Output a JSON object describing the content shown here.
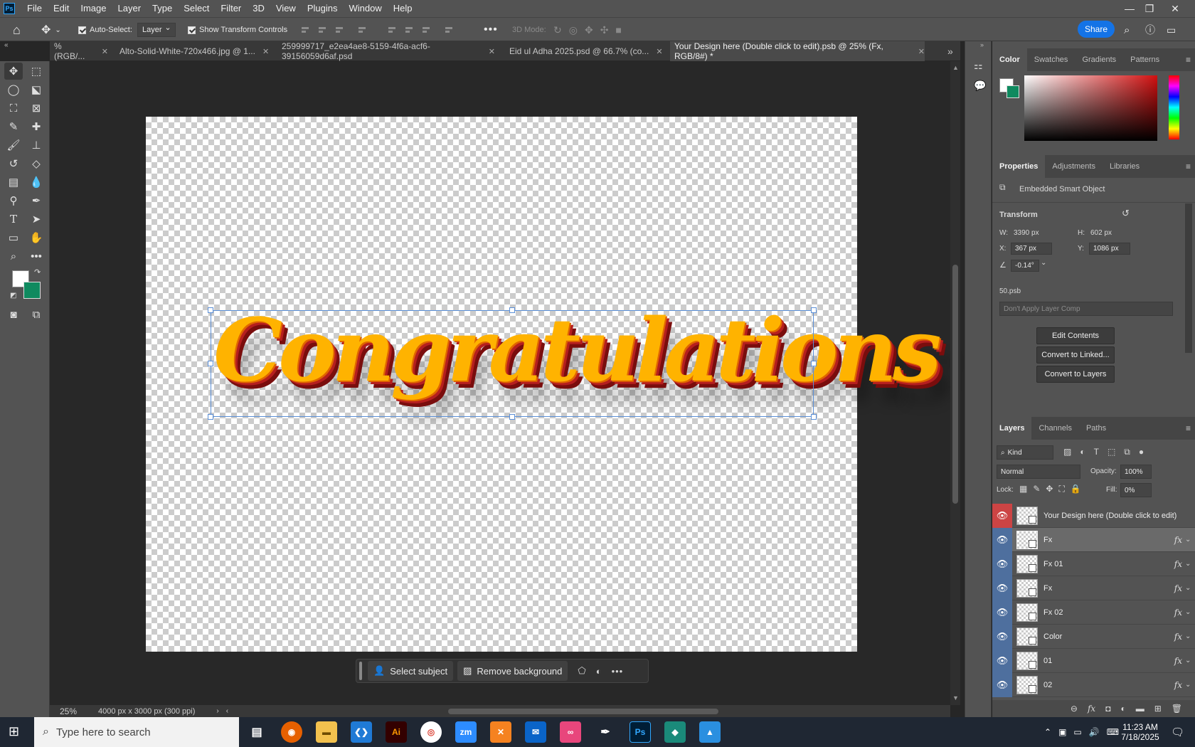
{
  "menu": [
    "File",
    "Edit",
    "Image",
    "Layer",
    "Type",
    "Select",
    "Filter",
    "3D",
    "View",
    "Plugins",
    "Window",
    "Help"
  ],
  "options_bar": {
    "auto_select_label": "Auto-Select:",
    "auto_select_value": "Layer",
    "show_transform_label": "Show Transform Controls",
    "mode_3d_label": "3D Mode:",
    "share_label": "Share"
  },
  "tabs": [
    {
      "label": "% (RGB/..."
    },
    {
      "label": "Alto-Solid-White-720x466.jpg @ 1..."
    },
    {
      "label": "259999717_e2ea4ae8-5159-4f6a-acf6-39156059d6af.psd"
    },
    {
      "label": "Eid ul Adha 2025.psd @ 66.7% (co..."
    },
    {
      "label": "Your Design here (Double click to edit).psb @ 25% (Fx, RGB/8#) *"
    }
  ],
  "canvas": {
    "art_text": "Congratulations"
  },
  "context_bar": {
    "select_subject": "Select subject",
    "remove_background": "Remove background"
  },
  "status": {
    "zoom": "25%",
    "doc_info": "4000 px x 3000 px (300 ppi)"
  },
  "color_panel": {
    "tabs": [
      "Color",
      "Swatches",
      "Gradients",
      "Patterns"
    ],
    "foreground": "#ffffff",
    "background": "#0f8a5f"
  },
  "properties_panel": {
    "tabs": [
      "Properties",
      "Adjustments",
      "Libraries"
    ],
    "object_type": "Embedded Smart Object",
    "transform_title": "Transform",
    "w_label": "W:",
    "w_value": "3390 px",
    "h_label": "H:",
    "h_value": "602 px",
    "x_label": "X:",
    "x_value": "367 px",
    "y_label": "Y:",
    "y_value": "1086 px",
    "angle_value": "-0.14°",
    "file_name": "50.psb",
    "layer_comp": "Don't Apply Layer Comp",
    "edit_contents": "Edit Contents",
    "convert_linked": "Convert to Linked...",
    "convert_layers": "Convert to Layers"
  },
  "layers_panel": {
    "tabs": [
      "Layers",
      "Channels",
      "Paths"
    ],
    "kind_label": "Kind",
    "blend_mode": "Normal",
    "opacity_label": "Opacity:",
    "opacity_value": "100%",
    "lock_label": "Lock:",
    "fill_label": "Fill:",
    "fill_value": "0%",
    "layers": [
      {
        "name": "Your Design here (Double click to edit)",
        "fx": ""
      },
      {
        "name": "Fx",
        "fx": "fx"
      },
      {
        "name": "Fx 01",
        "fx": "fx"
      },
      {
        "name": "Fx",
        "fx": "fx"
      },
      {
        "name": "Fx 02",
        "fx": "fx"
      },
      {
        "name": "Color",
        "fx": "fx"
      },
      {
        "name": "01",
        "fx": "fx"
      },
      {
        "name": "02",
        "fx": "fx"
      }
    ]
  },
  "taskbar": {
    "search_placeholder": "Type here to search",
    "time": "11:23 AM",
    "date": "7/18/2025",
    "apps": [
      "Ai",
      "zm",
      "Ps"
    ]
  }
}
